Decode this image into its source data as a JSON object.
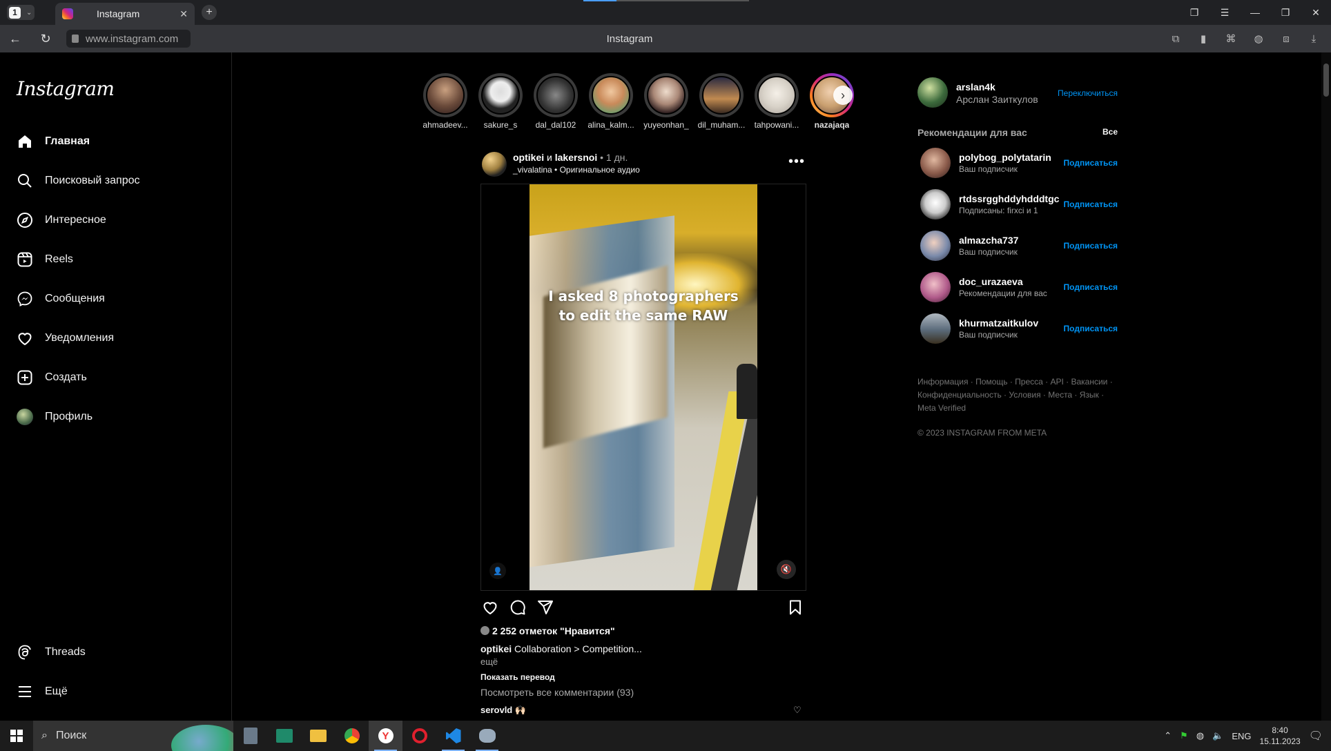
{
  "browser": {
    "tab_count": "1",
    "tab_title": "Instagram",
    "url": "www.instagram.com",
    "page_title": "Instagram"
  },
  "sidebar": {
    "logo": "Instagram",
    "items": [
      {
        "label": "Главная",
        "icon": "home-icon"
      },
      {
        "label": "Поисковый запрос",
        "icon": "search-icon"
      },
      {
        "label": "Интересное",
        "icon": "compass-icon"
      },
      {
        "label": "Reels",
        "icon": "reels-icon"
      },
      {
        "label": "Сообщения",
        "icon": "messenger-icon"
      },
      {
        "label": "Уведомления",
        "icon": "heart-icon"
      },
      {
        "label": "Создать",
        "icon": "create-icon"
      },
      {
        "label": "Профиль",
        "icon": "avatar"
      }
    ],
    "bottom_items": [
      {
        "label": "Threads",
        "icon": "threads-icon"
      },
      {
        "label": "Ещё",
        "icon": "menu-icon"
      }
    ]
  },
  "stories": [
    {
      "name": "ahmadeev...",
      "color": "#6a4a3a"
    },
    {
      "name": "sakure_s",
      "color": "#222222"
    },
    {
      "name": "dal_dal102",
      "color": "#555555"
    },
    {
      "name": "alina_kalm...",
      "color": "#c98a5a"
    },
    {
      "name": "yuyeonhan_",
      "color": "#aa8877"
    },
    {
      "name": "dil_muham...",
      "color": "#c08a50"
    },
    {
      "name": "tahpowani...",
      "color": "#d8d2c8"
    },
    {
      "name": "nazajaqa",
      "color": "#caa070"
    }
  ],
  "post": {
    "author_line": "optikei",
    "author_and": " и ",
    "coauthor": "lakersnoi",
    "time": " • 1 дн.",
    "audio": "_vivalatina • Оригинальное аудио",
    "overlay_line1": "I asked 8 photographers",
    "overlay_line2": "to edit the same RAW",
    "likes": "2 252 отметок \"Нравится\"",
    "caption_user": "optikei",
    "caption_text": " Collaboration > Competition...",
    "more": "ещё",
    "translate": "Показать перевод",
    "view_comments": "Посмотреть все комментарии (93)",
    "comment_user": "serovld",
    "comment_text": " 🙌🏻"
  },
  "right": {
    "username": "arslan4k",
    "fullname": "Арслан Заиткулов",
    "switch": "Переключиться",
    "rec_title": "Рекомендации для вас",
    "all": "Все",
    "suggestions": [
      {
        "user": "polybog_polytatarin",
        "sub": "Ваш подписчик",
        "action": "Подписаться",
        "color": "#8a5a4a"
      },
      {
        "user": "rtdssrgghddyhdddtgc",
        "sub": "Подписаны: firxci и 1",
        "action": "Подписаться",
        "color": "#dddddd"
      },
      {
        "user": "almazcha737",
        "sub": "Ваш подписчик",
        "action": "Подписаться",
        "color": "#7a8aaa"
      },
      {
        "user": "doc_urazaeva",
        "sub": "Рекомендации для вас",
        "action": "Подписаться",
        "color": "#b05a8a"
      },
      {
        "user": "khurmatzaitkulov",
        "sub": "Ваш подписчик",
        "action": "Подписаться",
        "color": "#5a6a7a"
      }
    ],
    "footer_links": "Информация · Помощь · Пресса · API · Вакансии · Конфиденциальность · Условия · Места · Язык · Meta Verified",
    "copyright": "© 2023 INSTAGRAM FROM META"
  },
  "taskbar": {
    "search": "Поиск",
    "lang": "ENG",
    "time": "8:40",
    "date": "15.11.2023"
  }
}
